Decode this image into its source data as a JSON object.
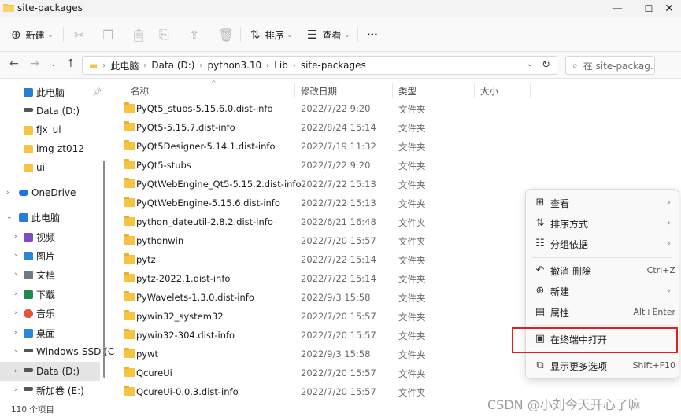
{
  "window": {
    "title": "site-packages",
    "minimize": "—",
    "maximize": "☐",
    "close": "✕"
  },
  "toolbar": {
    "new_label": "新建",
    "sort_label": "排序",
    "view_label": "查看",
    "more_label": "···"
  },
  "address": {
    "segments": [
      "此电脑",
      "Data (D:)",
      "python3.10",
      "Lib",
      "site-packages"
    ],
    "search_placeholder": "在 site-packag..."
  },
  "sidebar": {
    "items": [
      {
        "label": "此电脑",
        "icon": "monitor-icon",
        "color": "#2b7cd3"
      },
      {
        "label": "Data (D:)",
        "icon": "drive-icon",
        "color": "#555555"
      },
      {
        "label": "fjx_ui",
        "icon": "folder-icon",
        "color": "#f5c542"
      },
      {
        "label": "img-zt012",
        "icon": "folder-icon",
        "color": "#f5c542"
      },
      {
        "label": "ui",
        "icon": "folder-icon",
        "color": "#f5c542"
      },
      {
        "label": "OneDrive",
        "icon": "cloud-icon",
        "color": "#1a73e8"
      },
      {
        "label": "此电脑",
        "icon": "monitor-icon",
        "color": "#2b7cd3"
      },
      {
        "label": "视频",
        "icon": "video-icon",
        "color": "#7b4fbf"
      },
      {
        "label": "图片",
        "icon": "picture-icon",
        "color": "#2a86d6"
      },
      {
        "label": "文档",
        "icon": "document-icon",
        "color": "#6c7a89"
      },
      {
        "label": "下载",
        "icon": "download-icon",
        "color": "#1f8a4c"
      },
      {
        "label": "音乐",
        "icon": "music-icon",
        "color": "#e8533b"
      },
      {
        "label": "桌面",
        "icon": "desktop-icon",
        "color": "#2a86d6"
      },
      {
        "label": "Windows-SSD (C",
        "icon": "drive-icon",
        "color": "#555555"
      },
      {
        "label": "Data (D:)",
        "icon": "drive-icon",
        "color": "#555555"
      },
      {
        "label": "新加卷 (E:)",
        "icon": "drive-icon",
        "color": "#555555"
      }
    ]
  },
  "columns": {
    "name": "名称",
    "date": "修改日期",
    "type": "类型",
    "size": "大小"
  },
  "files": [
    {
      "name": "PyQt5_stubs-5.15.6.0.dist-info",
      "date": "2022/7/22 9:20",
      "type": "文件夹"
    },
    {
      "name": "PyQt5-5.15.7.dist-info",
      "date": "2022/8/24 15:14",
      "type": "文件夹"
    },
    {
      "name": "PyQt5Designer-5.14.1.dist-info",
      "date": "2022/7/19 11:32",
      "type": "文件夹"
    },
    {
      "name": "PyQt5-stubs",
      "date": "2022/7/22 9:20",
      "type": "文件夹"
    },
    {
      "name": "PyQtWebEngine_Qt5-5.15.2.dist-info",
      "date": "2022/7/22 15:13",
      "type": "文件夹"
    },
    {
      "name": "PyQtWebEngine-5.15.6.dist-info",
      "date": "2022/7/22 15:13",
      "type": "文件夹"
    },
    {
      "name": "python_dateutil-2.8.2.dist-info",
      "date": "2022/6/21 16:48",
      "type": "文件夹"
    },
    {
      "name": "pythonwin",
      "date": "2022/7/20 15:57",
      "type": "文件夹"
    },
    {
      "name": "pytz",
      "date": "2022/7/22 15:14",
      "type": "文件夹"
    },
    {
      "name": "pytz-2022.1.dist-info",
      "date": "2022/7/22 15:14",
      "type": "文件夹"
    },
    {
      "name": "PyWavelets-1.3.0.dist-info",
      "date": "2022/9/3 15:58",
      "type": "文件夹"
    },
    {
      "name": "pywin32_system32",
      "date": "2022/7/20 15:57",
      "type": "文件夹"
    },
    {
      "name": "pywin32-304.dist-info",
      "date": "2022/7/20 15:57",
      "type": "文件夹"
    },
    {
      "name": "pywt",
      "date": "2022/9/3 15:58",
      "type": "文件夹"
    },
    {
      "name": "QcureUi",
      "date": "2022/7/20 15:57",
      "type": "文件夹"
    },
    {
      "name": "QcureUi-0.0.3.dist-info",
      "date": "2022/7/20 15:57",
      "type": "文件夹"
    }
  ],
  "status": {
    "item_count": "110 个项目"
  },
  "context_menu": {
    "items": [
      {
        "label": "查看",
        "icon": "grid-icon",
        "shortcut": "",
        "submenu": true
      },
      {
        "label": "排序方式",
        "icon": "sort-icon",
        "shortcut": "",
        "submenu": true
      },
      {
        "label": "分组依据",
        "icon": "group-icon",
        "shortcut": "",
        "submenu": true
      },
      {
        "label": "撤消 删除",
        "icon": "undo-icon",
        "shortcut": "Ctrl+Z",
        "submenu": false
      },
      {
        "label": "新建",
        "icon": "plus-icon",
        "shortcut": "",
        "submenu": true
      },
      {
        "label": "属性",
        "icon": "properties-icon",
        "shortcut": "Alt+Enter",
        "submenu": false
      },
      {
        "label": "在终端中打开",
        "icon": "terminal-icon",
        "shortcut": "",
        "submenu": false
      },
      {
        "label": "显示更多选项",
        "icon": "more-options-icon",
        "shortcut": "Shift+F10",
        "submenu": false
      }
    ],
    "highlight_color": "#e02020"
  },
  "watermark": "CSDN @小刘今天开心了嘛"
}
